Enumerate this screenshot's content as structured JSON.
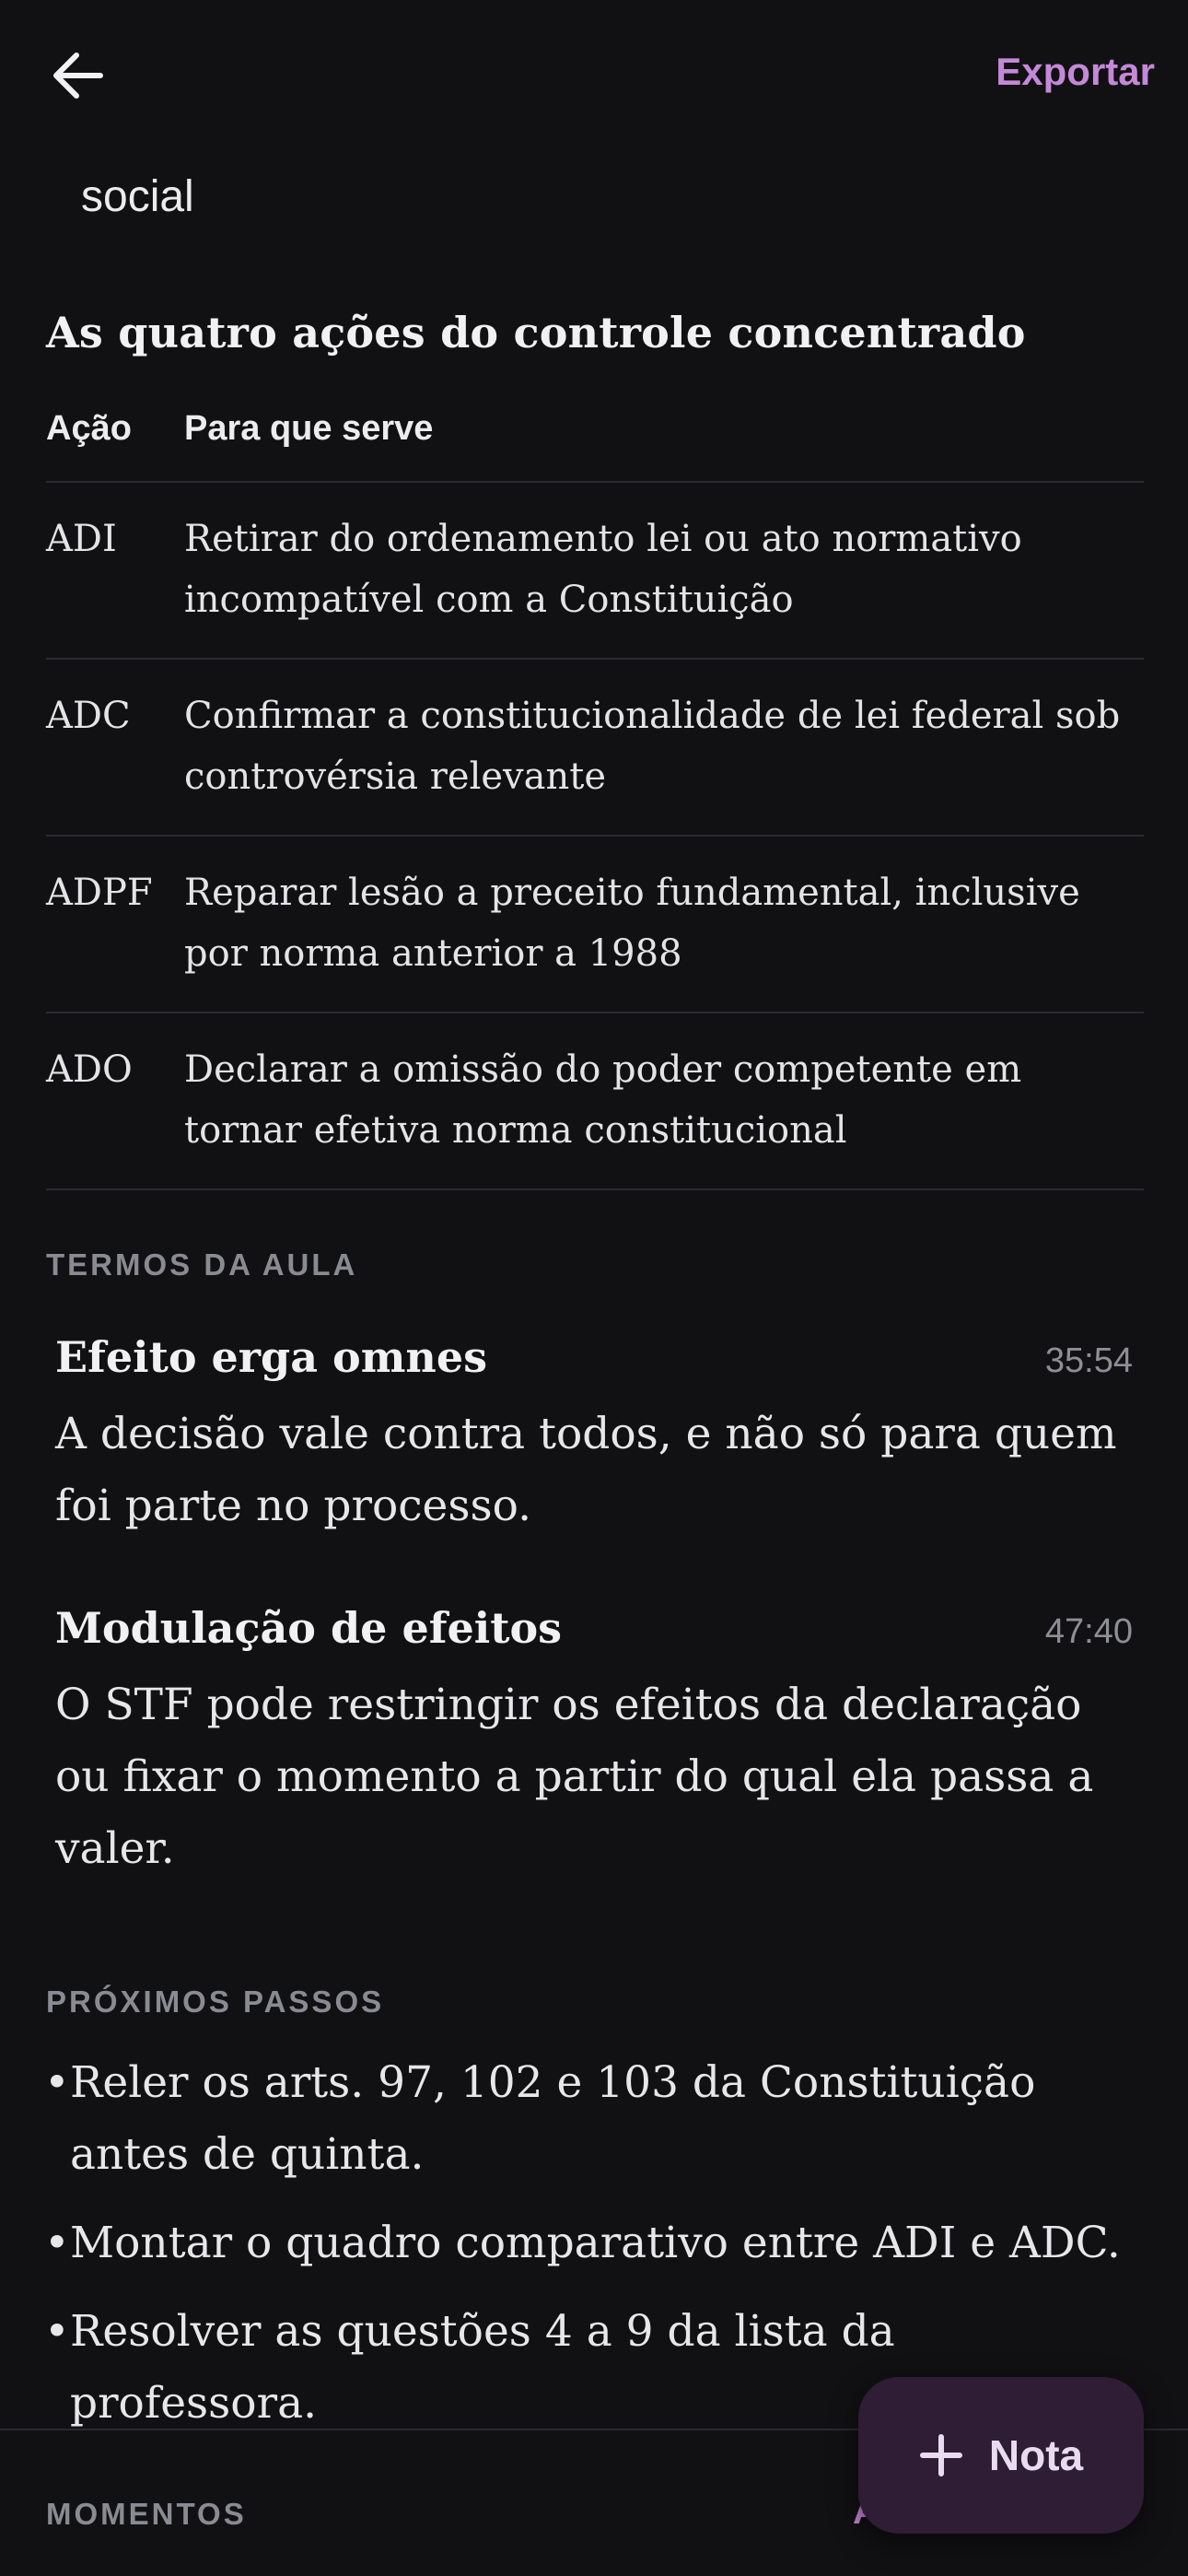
{
  "header": {
    "back_icon": "arrow-left-icon",
    "export_label": "Exportar",
    "accent_color": "#c588d8"
  },
  "fade_word": "social",
  "table_section": {
    "title": "As quatro ações do controle concentrado",
    "columns": [
      "Ação",
      "Para que serve"
    ],
    "rows": [
      {
        "action": "ADI",
        "purpose": "Retirar do ordenamento lei ou ato normativo incompatível com a Constituição"
      },
      {
        "action": "ADC",
        "purpose": "Confirmar a constitucionalidade de lei federal sob controvérsia relevante"
      },
      {
        "action": "ADPF",
        "purpose": "Reparar lesão a preceito fundamental, inclusive por norma anterior a 1988"
      },
      {
        "action": "ADO",
        "purpose": "Declarar a omissão do poder competente em tornar efetiva norma constitucional"
      }
    ]
  },
  "terms": {
    "label": "TERMOS DA AULA",
    "items": [
      {
        "name": "Efeito erga omnes",
        "time": "35:54",
        "description": "A decisão vale contra todos, e não só para quem foi parte no processo."
      },
      {
        "name": "Modulação de efeitos",
        "time": "47:40",
        "description": "O STF pode restringir os efeitos da declaração ou fixar o momento a partir do qual ela passa a valer."
      }
    ]
  },
  "next_steps": {
    "label": "PRÓXIMOS PASSOS",
    "items": [
      "Reler os arts. 97, 102 e 103 da Constituição antes de quinta.",
      "Montar o quadro comparativo entre ADI e ADC.",
      "Resolver as questões 4 a 9 da lista da professora."
    ]
  },
  "moments": {
    "label": "MOMENTOS",
    "link_partial": "A"
  },
  "fab": {
    "icon": "plus-icon",
    "label": "Nota"
  }
}
